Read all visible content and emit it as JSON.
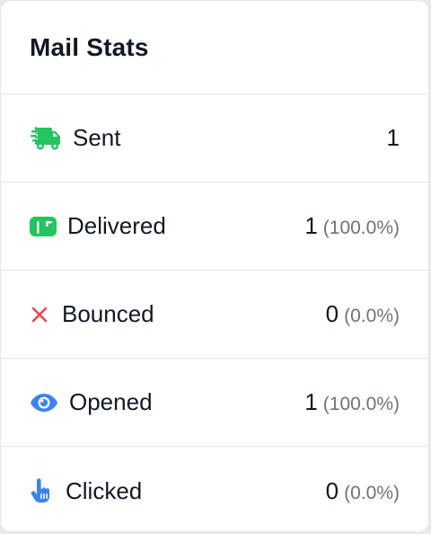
{
  "card": {
    "title": "Mail Stats"
  },
  "colors": {
    "sent_icon": "#22c55e",
    "delivered_icon": "#22c55e",
    "bounced_icon": "#ef4444",
    "opened_icon": "#3b82f6",
    "clicked_icon": "#3b82f6",
    "text_primary": "#111827",
    "text_muted": "#6b7280",
    "divider": "#e5e7eb"
  },
  "stats": [
    {
      "key": "sent",
      "icon": "truck-fast-icon",
      "label": "Sent",
      "count": "1",
      "percent": ""
    },
    {
      "key": "delivered",
      "icon": "mailbox-icon",
      "label": "Delivered",
      "count": "1",
      "percent": "(100.0%)"
    },
    {
      "key": "bounced",
      "icon": "x-mark-icon",
      "label": "Bounced",
      "count": "0",
      "percent": "(0.0%)"
    },
    {
      "key": "opened",
      "icon": "eye-icon",
      "label": "Opened",
      "count": "1",
      "percent": "(100.0%)"
    },
    {
      "key": "clicked",
      "icon": "pointer-hand-icon",
      "label": "Clicked",
      "count": "0",
      "percent": "(0.0%)"
    }
  ]
}
